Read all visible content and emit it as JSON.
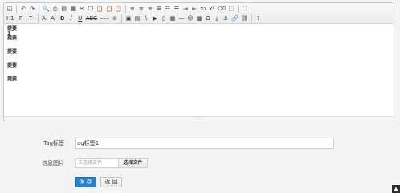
{
  "toolbar": {
    "row1": [
      {
        "name": "source-icon",
        "glyph": "◱"
      },
      {
        "sep": true
      },
      {
        "name": "undo-icon",
        "glyph": "↶"
      },
      {
        "name": "redo-icon",
        "glyph": "↷"
      },
      {
        "sep": true
      },
      {
        "name": "preview-icon",
        "glyph": "🔍"
      },
      {
        "name": "print-icon",
        "glyph": "⎙"
      },
      {
        "name": "template-icon",
        "glyph": "▤"
      },
      {
        "name": "code-icon",
        "glyph": "▦"
      },
      {
        "name": "cut-icon",
        "glyph": "✂"
      },
      {
        "name": "copy-icon",
        "glyph": "❐"
      },
      {
        "name": "paste-icon",
        "glyph": "📋"
      },
      {
        "name": "paste-plain-icon",
        "glyph": "📋"
      },
      {
        "name": "paste-word-icon",
        "glyph": "📋"
      },
      {
        "sep": true
      },
      {
        "name": "align-left-icon",
        "glyph": "≡"
      },
      {
        "name": "align-center-icon",
        "glyph": "≡"
      },
      {
        "name": "align-right-icon",
        "glyph": "≡"
      },
      {
        "name": "align-justify-icon",
        "glyph": "≣"
      },
      {
        "name": "ordered-list-icon",
        "glyph": "☷"
      },
      {
        "name": "unordered-list-icon",
        "glyph": "☰"
      },
      {
        "name": "indent-icon",
        "glyph": "⇥"
      },
      {
        "name": "outdent-icon",
        "glyph": "⇤"
      },
      {
        "name": "subscript-icon",
        "glyph": "x₂"
      },
      {
        "name": "superscript-icon",
        "glyph": "x²"
      },
      {
        "name": "clear-format-icon",
        "glyph": "⌫"
      },
      {
        "name": "select-all-icon",
        "glyph": "⬚"
      },
      {
        "sep": true
      },
      {
        "name": "fullscreen-icon",
        "glyph": "⛶"
      }
    ],
    "row2": [
      {
        "name": "heading-icon",
        "glyph": "H1·"
      },
      {
        "name": "font-family-icon",
        "glyph": "F·"
      },
      {
        "name": "font-size-icon",
        "glyph": "·T·"
      },
      {
        "sep": true
      },
      {
        "name": "font-color-icon",
        "glyph": "A·"
      },
      {
        "name": "highlight-icon",
        "glyph": "A·"
      },
      {
        "name": "bold-icon",
        "glyph": "B",
        "style": "b"
      },
      {
        "name": "italic-icon",
        "glyph": "I",
        "style": "i"
      },
      {
        "name": "underline-icon",
        "glyph": "U",
        "style": "u"
      },
      {
        "name": "strikethrough-icon",
        "glyph": "ABC",
        "style": "s"
      },
      {
        "name": "line-height-icon",
        "glyph": "⩶"
      },
      {
        "name": "remove-format-icon",
        "glyph": "⊘"
      },
      {
        "sep": true
      },
      {
        "name": "image-icon",
        "glyph": "▣"
      },
      {
        "name": "multi-image-icon",
        "glyph": "▤"
      },
      {
        "name": "flash-icon",
        "glyph": "ϟ"
      },
      {
        "name": "media-icon",
        "glyph": "▶"
      },
      {
        "name": "attachment-icon",
        "glyph": "▯"
      },
      {
        "name": "table-icon",
        "glyph": "▦"
      },
      {
        "name": "hr-icon",
        "glyph": "—"
      },
      {
        "name": "emoticon-icon",
        "glyph": "☺"
      },
      {
        "name": "baidu-map-icon",
        "glyph": "▩"
      },
      {
        "name": "special-char-icon",
        "glyph": "Ω"
      },
      {
        "name": "pagebreak-icon",
        "glyph": "⤓"
      },
      {
        "name": "anchor-icon",
        "glyph": "⚓"
      },
      {
        "name": "link-icon",
        "glyph": "🔗"
      },
      {
        "name": "unlink-icon",
        "glyph": "⛓"
      },
      {
        "sep": true
      },
      {
        "name": "help-icon",
        "glyph": "?"
      }
    ]
  },
  "editor_lines": [
    {
      "text": "提要",
      "gap": 0
    },
    {
      "text": "1",
      "gap": 0
    },
    {
      "text": "提要",
      "gap": 0
    },
    {
      "text": "提要",
      "gap": 11
    },
    {
      "text": "提要",
      "gap": 11
    },
    {
      "text": "提要",
      "gap": 11
    }
  ],
  "resize_glyph": "⋯",
  "form": {
    "tag_label": "Tag标签",
    "tag_value": "ag标签1",
    "image_label": "信息图片",
    "file_placeholder": "未选择文件",
    "file_button": "选择文件",
    "save_button": "保 存",
    "back_button": "返 回"
  },
  "corner_glyph": "▲"
}
